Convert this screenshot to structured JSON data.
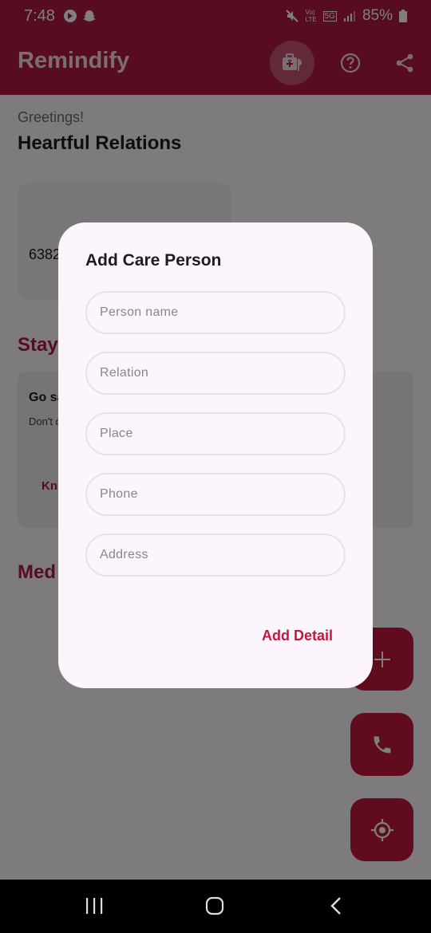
{
  "status_bar": {
    "time": "7:48",
    "battery": "85%",
    "network_label_top": "Vo)",
    "network_label_bottom": "LTE",
    "network_5g": "5G"
  },
  "app_bar": {
    "title": "Remindify",
    "actions": [
      "medical-kit-icon",
      "help-icon",
      "share-icon"
    ]
  },
  "home": {
    "greeting": "Greetings!",
    "subtitle": "Heartful Relations",
    "care_card_phone": "6382",
    "stay_title": "Stay",
    "tip_card": {
      "title": "Go sa",
      "body": "Don't data a day!",
      "link": "Kn"
    },
    "medicines_title": "Med"
  },
  "fabs": [
    "add-icon",
    "phone-icon",
    "location-target-icon"
  ],
  "dialog": {
    "title": "Add Care Person",
    "fields": [
      {
        "name": "person-name-field",
        "placeholder": "Person name",
        "value": ""
      },
      {
        "name": "relation-field",
        "placeholder": "Relation",
        "value": ""
      },
      {
        "name": "place-field",
        "placeholder": "Place",
        "value": ""
      },
      {
        "name": "phone-field",
        "placeholder": "Phone",
        "value": ""
      },
      {
        "name": "address-field",
        "placeholder": "Address",
        "value": ""
      }
    ],
    "submit_label": "Add Detail"
  },
  "colors": {
    "primary": "#b0193f",
    "accent": "#c2173f",
    "dialog_bg": "#fcf5fc"
  }
}
